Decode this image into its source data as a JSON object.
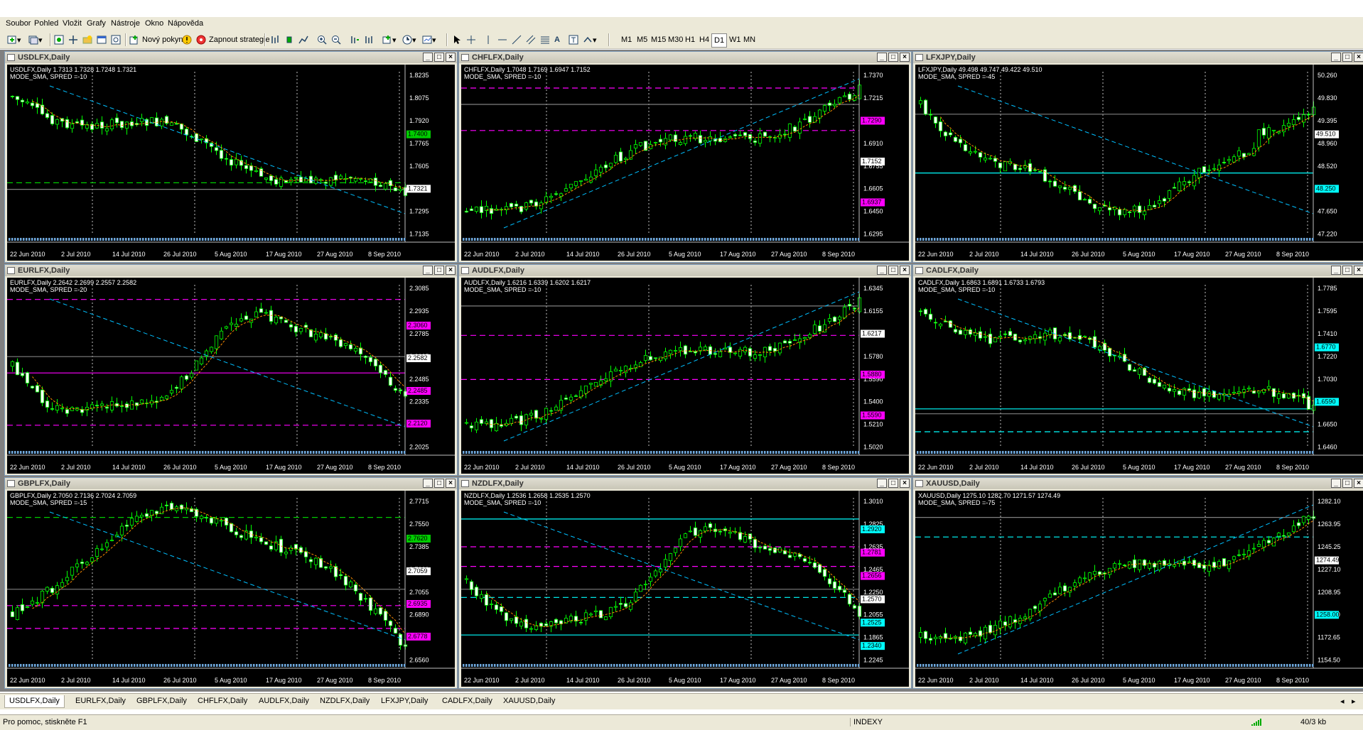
{
  "menu": [
    "Soubor",
    "Pohled",
    "Vložit",
    "Grafy",
    "Nástroje",
    "Okno",
    "Nápověda"
  ],
  "toolbar": {
    "new_order": "Nový pokyn",
    "start_strategy": "Zapnout strategie",
    "timeframes": [
      "M1",
      "M5",
      "M15",
      "M30",
      "H1",
      "H4",
      "D1",
      "W1",
      "MN"
    ]
  },
  "xlabels": [
    "22 Jun 2010",
    "2 Jul 2010",
    "14 Jul 2010",
    "26 Jul 2010",
    "5 Aug 2010",
    "17 Aug 2010",
    "27 Aug 2010",
    "8 Sep 2010"
  ],
  "windows": [
    {
      "title": "USDLFX,Daily",
      "info1": "USDLFX,Daily  1.7313 1.7328 1.7248 1.7321",
      "info2": "MODE_SMA, SPRED =-10",
      "price_labels": [
        "1.8235",
        "1.8075",
        "1.7920",
        "1.7765",
        "1.7605",
        "1.7450",
        "1.7295",
        "1.7135"
      ],
      "marked": [
        {
          "value": "1.7400",
          "color": "#00CC00"
        },
        {
          "value": "1.7321",
          "color": "#FFFFFF"
        }
      ],
      "trend": "down",
      "levels": [
        {
          "pos": 0.68,
          "color": "#00CC00",
          "dash": true
        },
        {
          "pos": 0.72,
          "color": "#808080",
          "dash": false
        }
      ]
    },
    {
      "title": "CHFLFX,Daily",
      "info1": "CHFLFX,Daily  1.7048 1.7169 1.6947 1.7152",
      "info2": "MODE_SMA, SPRED =-10",
      "price_labels": [
        "1.7370",
        "1.7215",
        "1.7065",
        "1.6910",
        "1.6755",
        "1.6605",
        "1.6450",
        "1.6295"
      ],
      "marked": [
        {
          "value": "1.7290",
          "color": "#FF00FF"
        },
        {
          "value": "1.7152",
          "color": "#FFFFFF"
        },
        {
          "value": "1.6937",
          "color": "#FF00FF"
        }
      ],
      "trend": "up",
      "levels": [
        {
          "pos": 0.1,
          "color": "#FF00FF",
          "dash": true
        },
        {
          "pos": 0.2,
          "color": "#808080",
          "dash": false
        },
        {
          "pos": 0.36,
          "color": "#FF00FF",
          "dash": true
        }
      ]
    },
    {
      "title": "LFXJPY,Daily",
      "info1": "LFXJPY,Daily  49.498 49.747 49.422 49.510",
      "info2": "MODE_SMA, SPRED =-45",
      "price_labels": [
        "50.260",
        "49.830",
        "49.395",
        "48.960",
        "48.520",
        "48.090",
        "47.650",
        "47.220"
      ],
      "marked": [
        {
          "value": "49.510",
          "color": "#FFFFFF"
        },
        {
          "value": "48.250",
          "color": "#00FFFF"
        }
      ],
      "trend": "downup",
      "levels": [
        {
          "pos": 0.26,
          "color": "#808080",
          "dash": false
        },
        {
          "pos": 0.62,
          "color": "#00FFFF",
          "dash": false
        }
      ]
    },
    {
      "title": "EURLFX,Daily",
      "info1": "EURLFX,Daily  2.2642 2.2699 2.2557 2.2582",
      "info2": "MODE_SMA, SPRED =-20",
      "price_labels": [
        "2.3085",
        "2.2935",
        "2.2785",
        "2.2635",
        "2.2485",
        "2.2335",
        "2.2180",
        "2.2025"
      ],
      "marked": [
        {
          "value": "2.3060",
          "color": "#FF00FF"
        },
        {
          "value": "2.2582",
          "color": "#FFFFFF"
        },
        {
          "value": "2.2485",
          "color": "#FF00FF"
        },
        {
          "value": "2.2120",
          "color": "#FF00FF"
        }
      ],
      "trend": "wave",
      "levels": [
        {
          "pos": 0.09,
          "color": "#FF00FF",
          "dash": true
        },
        {
          "pos": 0.44,
          "color": "#808080",
          "dash": false
        },
        {
          "pos": 0.54,
          "color": "#FF00FF",
          "dash": false
        },
        {
          "pos": 0.86,
          "color": "#FF00FF",
          "dash": true
        }
      ]
    },
    {
      "title": "AUDLFX,Daily",
      "info1": "AUDLFX,Daily  1.6216 1.6339 1.6202 1.6217",
      "info2": "MODE_SMA, SPRED =-10",
      "price_labels": [
        "1.6345",
        "1.6155",
        "1.5965",
        "1.5780",
        "1.5590",
        "1.5400",
        "1.5210",
        "1.5020"
      ],
      "marked": [
        {
          "value": "1.6217",
          "color": "#FFFFFF"
        },
        {
          "value": "1.5880",
          "color": "#FF00FF"
        },
        {
          "value": "1.5590",
          "color": "#FF00FF"
        }
      ],
      "trend": "up",
      "levels": [
        {
          "pos": 0.13,
          "color": "#808080",
          "dash": false
        },
        {
          "pos": 0.31,
          "color": "#FF00FF",
          "dash": true
        },
        {
          "pos": 0.58,
          "color": "#FF00FF",
          "dash": true
        }
      ]
    },
    {
      "title": "CADLFX,Daily",
      "info1": "CADLFX,Daily  1.6863 1.6891 1.6733 1.6793",
      "info2": "MODE_SMA, SPRED =-10",
      "price_labels": [
        "1.7785",
        "1.7595",
        "1.7410",
        "1.7220",
        "1.7030",
        "1.6840",
        "1.6650",
        "1.6460"
      ],
      "marked": [
        {
          "value": "1.6770",
          "color": "#00FFFF"
        },
        {
          "value": "1.6590",
          "color": "#00FFFF"
        }
      ],
      "trend": "down",
      "levels": [
        {
          "pos": 0.76,
          "color": "#00FFFF",
          "dash": false
        },
        {
          "pos": 0.79,
          "color": "#808080",
          "dash": false
        },
        {
          "pos": 0.9,
          "color": "#00FFFF",
          "dash": true
        }
      ]
    },
    {
      "title": "GBPLFX,Daily",
      "info1": "GBPLFX,Daily  2.7050 2.7136 2.7024 2.7059",
      "info2": "MODE_SMA, SPRED =-15",
      "price_labels": [
        "2.7715",
        "2.7550",
        "2.7385",
        "2.7220",
        "2.7055",
        "2.6890",
        "2.6725",
        "2.6560"
      ],
      "marked": [
        {
          "value": "2.7620",
          "color": "#00CC00"
        },
        {
          "value": "2.7059",
          "color": "#FFFFFF"
        },
        {
          "value": "2.6935",
          "color": "#FF00FF"
        },
        {
          "value": "2.6778",
          "color": "#FF00FF"
        }
      ],
      "trend": "updown",
      "levels": [
        {
          "pos": 0.12,
          "color": "#00CC00",
          "dash": true
        },
        {
          "pos": 0.56,
          "color": "#808080",
          "dash": false
        },
        {
          "pos": 0.66,
          "color": "#FF00FF",
          "dash": true
        },
        {
          "pos": 0.8,
          "color": "#FF00FF",
          "dash": true
        }
      ]
    },
    {
      "title": "NZDLFX,Daily",
      "info1": "NZDLFX,Daily  1.2536 1.2658 1.2535 1.2570",
      "info2": "MODE_SMA, SPRED =-10",
      "price_labels": [
        "1.3010",
        "1.2825",
        "1.2635",
        "1.2465",
        "1.2250",
        "1.2055",
        "1.1865",
        "1.2245"
      ],
      "marked": [
        {
          "value": "1.2920",
          "color": "#00FFFF"
        },
        {
          "value": "1.2781",
          "color": "#FF00FF"
        },
        {
          "value": "1.2656",
          "color": "#FF00FF"
        },
        {
          "value": "1.2570",
          "color": "#FFFFFF"
        },
        {
          "value": "1.2525",
          "color": "#00FFFF"
        },
        {
          "value": "1.2340",
          "color": "#00FFFF"
        }
      ],
      "trend": "wave",
      "levels": [
        {
          "pos": 0.13,
          "color": "#00FFFF",
          "dash": false
        },
        {
          "pos": 0.3,
          "color": "#FF00FF",
          "dash": true
        },
        {
          "pos": 0.42,
          "color": "#FF00FF",
          "dash": true
        },
        {
          "pos": 0.56,
          "color": "#808080",
          "dash": false
        },
        {
          "pos": 0.61,
          "color": "#00FFFF",
          "dash": true
        },
        {
          "pos": 0.84,
          "color": "#00FFFF",
          "dash": false
        }
      ]
    },
    {
      "title": "XAUUSD,Daily",
      "info1": "XAUUSD,Daily  1275.10 1282.70 1271.57 1274.49",
      "info2": "MODE_SMA, SPRED =-75",
      "price_labels": [
        "1282.10",
        "1263.95",
        "1245.25",
        "1227.10",
        "1208.95",
        "1190.80",
        "1172.65",
        "1154.50"
      ],
      "marked": [
        {
          "value": "1274.49",
          "color": "#FFFFFF"
        },
        {
          "value": "1258.00",
          "color": "#00FFFF"
        }
      ],
      "trend": "up",
      "levels": [
        {
          "pos": 0.12,
          "color": "#808080",
          "dash": false
        },
        {
          "pos": 0.24,
          "color": "#00FFFF",
          "dash": true
        }
      ]
    }
  ],
  "tabs": [
    "USDLFX,Daily",
    "EURLFX,Daily",
    "GBPLFX,Daily",
    "CHFLFX,Daily",
    "AUDLFX,Daily",
    "NZDLFX,Daily",
    "LFXJPY,Daily",
    "CADLFX,Daily",
    "XAUUSD,Daily"
  ],
  "status": {
    "help": "Pro pomoc, stiskněte F1",
    "profile": "INDEXY",
    "traffic": "40/3 kb"
  }
}
